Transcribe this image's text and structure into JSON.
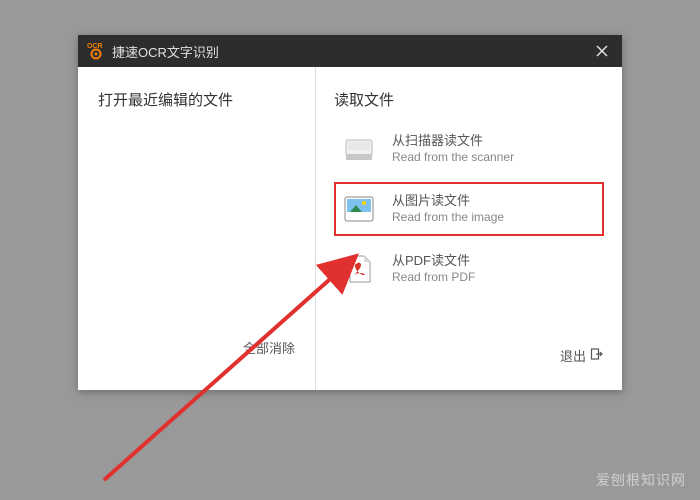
{
  "titleBar": {
    "title": "捷速OCR文字识别",
    "logoText": "OCR"
  },
  "leftPane": {
    "heading": "打开最近编辑的文件",
    "clearAll": "全部消除"
  },
  "rightPane": {
    "heading": "读取文件",
    "options": [
      {
        "title": "从扫描器读文件",
        "subtitle": "Read from the scanner"
      },
      {
        "title": "从图片读文件",
        "subtitle": "Read from the image"
      },
      {
        "title": "从PDF读文件",
        "subtitle": "Read from PDF"
      }
    ],
    "exit": "退出"
  },
  "watermark": "爱刨根知识网"
}
